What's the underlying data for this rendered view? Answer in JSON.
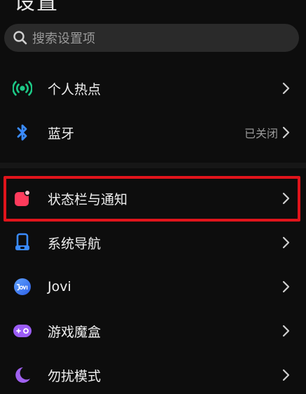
{
  "header": {
    "title": "设置"
  },
  "search": {
    "placeholder": "搜索设置项"
  },
  "items": [
    {
      "label": "个人热点",
      "icon": "hotspot-icon",
      "status": ""
    },
    {
      "label": "蓝牙",
      "icon": "bluetooth-icon",
      "status": "已关闭"
    },
    {
      "label": "状态栏与通知",
      "icon": "status-bar-notification-icon",
      "status": ""
    },
    {
      "label": "系统导航",
      "icon": "system-navigation-icon",
      "status": ""
    },
    {
      "label": "Jovi",
      "icon": "jovi-icon",
      "status": ""
    },
    {
      "label": "游戏魔盒",
      "icon": "game-box-icon",
      "status": ""
    },
    {
      "label": "勿扰模式",
      "icon": "moon-icon",
      "status": ""
    }
  ],
  "colors": {
    "hotspot": "#1dc987",
    "bluetooth": "#3a8bff",
    "status_bar": "#ff3b5c",
    "navigation": "#3a8bff",
    "jovi": "#3a7bff",
    "game": "#9b5cf6",
    "dnd": "#a061f0",
    "highlight": "#e0141b"
  }
}
